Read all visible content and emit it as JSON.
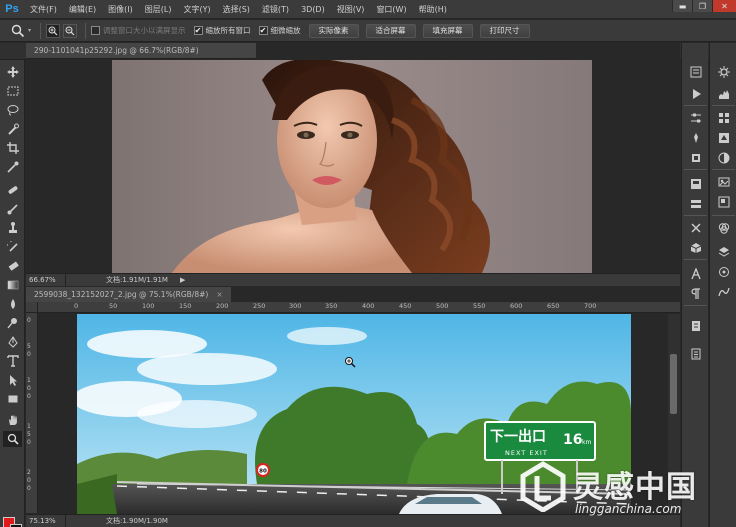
{
  "app": {
    "logo": "Ps"
  },
  "menu": [
    "文件(F)",
    "编辑(E)",
    "图像(I)",
    "图层(L)",
    "文字(Y)",
    "选择(S)",
    "滤镜(T)",
    "3D(D)",
    "视图(V)",
    "窗口(W)",
    "帮助(H)"
  ],
  "window_controls": {
    "minimize": "▬",
    "restore": "❐",
    "close": "✕"
  },
  "options": {
    "checkbox_resize": {
      "label": "调整窗口大小以满屏显示",
      "checked": false,
      "disabled": true
    },
    "checkbox_zoom_all": {
      "label": "缩放所有窗口",
      "checked": true
    },
    "checkbox_scrubby": {
      "label": "细微缩放",
      "checked": true
    },
    "btn_actual": "实际像素",
    "btn_fit": "适合屏幕",
    "btn_fill": "填充屏幕",
    "btn_print": "打印尺寸",
    "check_mark": "✔"
  },
  "documents": [
    {
      "tab": "290-1101041p25292.jpg @ 66.7%(RGB/8#)",
      "zoom": "66.67%",
      "docinfo": "文档:1.91M/1.91M"
    },
    {
      "tab": "2599038_132152027_2.jpg @ 75.1%(RGB/8#)",
      "zoom": "75.13%",
      "docinfo": "文档:1.90M/1.90M",
      "ruler_h": [
        "0",
        "50",
        "100",
        "150",
        "200",
        "250",
        "300",
        "350",
        "400",
        "450",
        "500",
        "550",
        "600",
        "650",
        "700"
      ],
      "ruler_v": [
        "0",
        "5",
        "0",
        "1",
        "0",
        "0",
        "1",
        "5",
        "0",
        "2",
        "0",
        "0"
      ]
    }
  ],
  "road_sign": {
    "text": "下一出口",
    "distance": "16",
    "unit": "km",
    "sub": "NEXT EXIT"
  },
  "speed_sign": "80",
  "watermark": {
    "cn": "灵感中国",
    "url": "lingganchina.com"
  },
  "colors": {
    "foreground": "#e01a1a",
    "background": "#111111",
    "ps_blue": "#2fa3f4"
  }
}
